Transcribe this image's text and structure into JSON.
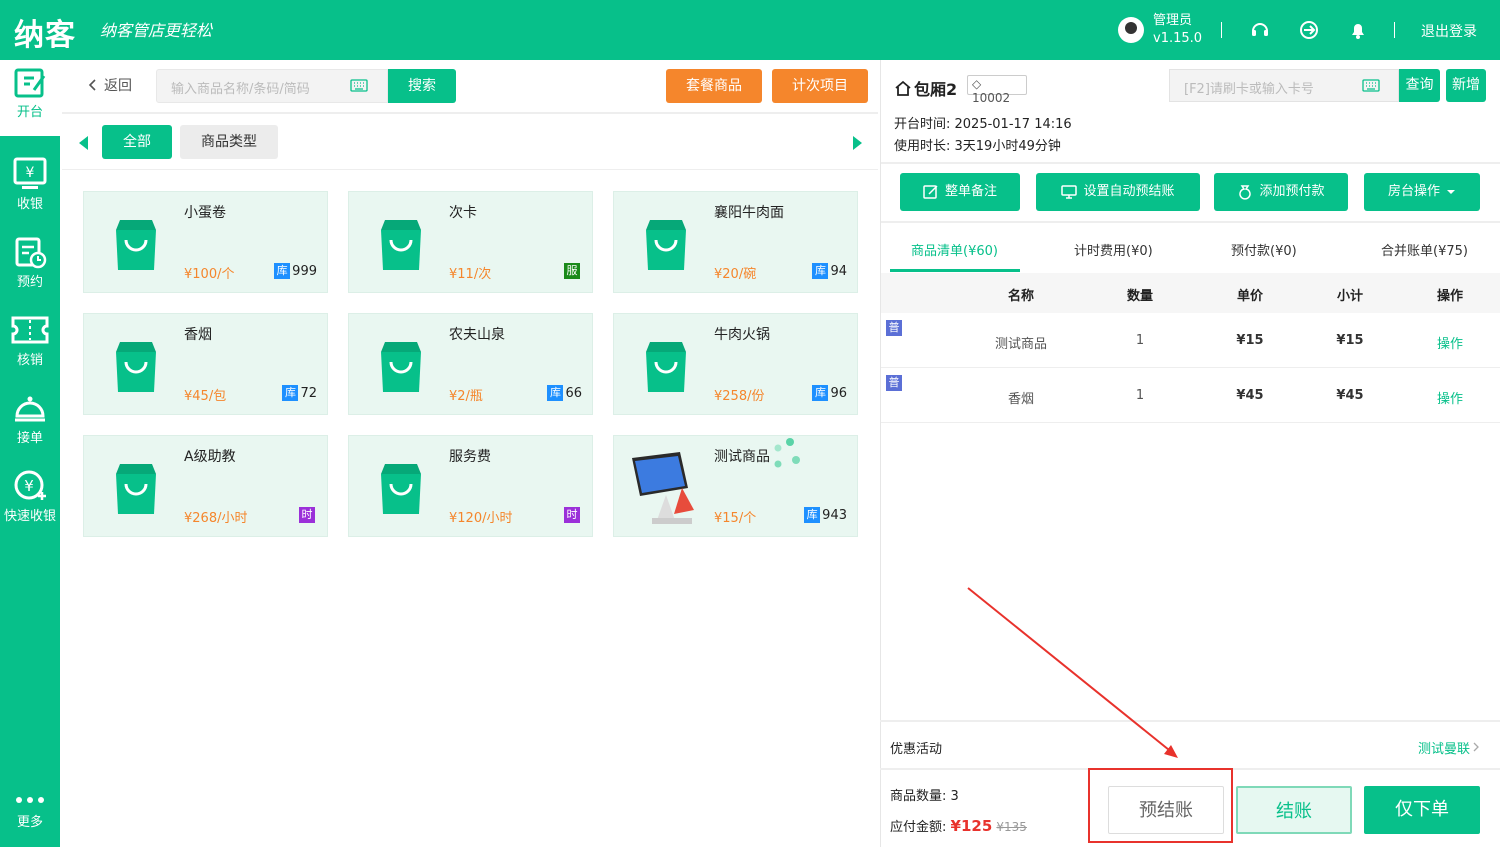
{
  "header": {
    "logo": "纳客",
    "slogan": "纳客管店更轻松",
    "username": "管理员",
    "version": "v1.15.0",
    "logout": "退出登录"
  },
  "sidebar": {
    "items": [
      {
        "label": "开台",
        "icon": "edit-icon"
      },
      {
        "label": "收银",
        "icon": "cashier-icon"
      },
      {
        "label": "预约",
        "icon": "calendar-icon"
      },
      {
        "label": "核销",
        "icon": "ticket-icon"
      },
      {
        "label": "接单",
        "icon": "bell-service-icon"
      },
      {
        "label": "快速收银",
        "icon": "quick-cash-icon"
      },
      {
        "label": "更多",
        "icon": "more-icon"
      }
    ]
  },
  "toolbar": {
    "back": "返回",
    "search_placeholder": "输入商品名称/条码/简码",
    "search_btn": "搜索",
    "combo_btn": "套餐商品",
    "count_btn": "计次项目"
  },
  "categories": {
    "all": "全部",
    "type": "商品类型"
  },
  "products": [
    {
      "name": "小蛋卷",
      "price": "¥100/个",
      "tag": "库",
      "tag_color": "#1e90ff",
      "stock": "999"
    },
    {
      "name": "次卡",
      "price": "¥11/次",
      "tag": "服",
      "tag_color": "#1a8a1a",
      "stock": ""
    },
    {
      "name": "襄阳牛肉面",
      "price": "¥20/碗",
      "tag": "库",
      "tag_color": "#1e90ff",
      "stock": "94"
    },
    {
      "name": "香烟",
      "price": "¥45/包",
      "tag": "库",
      "tag_color": "#1e90ff",
      "stock": "72"
    },
    {
      "name": "农夫山泉",
      "price": "¥2/瓶",
      "tag": "库",
      "tag_color": "#1e90ff",
      "stock": "66"
    },
    {
      "name": "牛肉火锅",
      "price": "¥258/份",
      "tag": "库",
      "tag_color": "#1e90ff",
      "stock": "96"
    },
    {
      "name": "A级助教",
      "price": "¥268/小时",
      "tag": "时",
      "tag_color": "#9b30d9",
      "stock": ""
    },
    {
      "name": "服务费",
      "price": "¥120/小时",
      "tag": "时",
      "tag_color": "#9b30d9",
      "stock": ""
    },
    {
      "name": "测试商品",
      "price": "¥15/个",
      "tag": "库",
      "tag_color": "#1e90ff",
      "stock": "943"
    }
  ],
  "room": {
    "name": "包厢2",
    "code": "10002",
    "open_time": "开台时间: 2025-01-17 14:16",
    "duration": "使用时长: 3天19小时49分钟",
    "card_placeholder": "[F2]请刷卡或输入卡号",
    "query_btn": "查询",
    "add_btn": "新增"
  },
  "actions": {
    "remark": "整单备注",
    "auto_settle": "设置自动预结账",
    "prepay": "添加预付款",
    "room_ops": "房台操作"
  },
  "tabs": [
    "商品清单(¥60)",
    "计时费用(¥0)",
    "预付款(¥0)",
    "合并账单(¥75)"
  ],
  "table": {
    "headers": [
      "名称",
      "数量",
      "单价",
      "小计",
      "操作"
    ],
    "rows": [
      {
        "badge": "普",
        "name": "测试商品",
        "qty": "1",
        "price": "¥15",
        "subtotal": "¥15",
        "op": "操作"
      },
      {
        "badge": "普",
        "name": "香烟",
        "qty": "1",
        "price": "¥45",
        "subtotal": "¥45",
        "op": "操作"
      }
    ]
  },
  "promo": {
    "label": "优惠活动",
    "value": "测试曼联"
  },
  "footer": {
    "count_label": "商品数量: ",
    "count": "3",
    "amount_label": "应付金额: ",
    "amount": "¥125",
    "original": "¥135",
    "pre_settle": "预结账",
    "settle": "结账",
    "order_only": "仅下单"
  },
  "colors": {
    "brand": "#07c08a",
    "orange": "#f5862c",
    "red": "#e8322c"
  }
}
